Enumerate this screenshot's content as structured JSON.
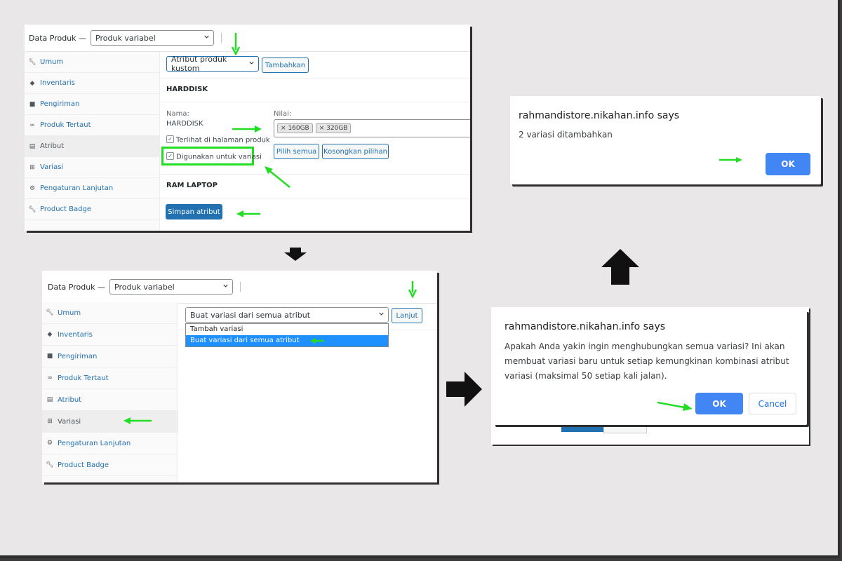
{
  "panel1": {
    "data_label": "Data Produk —",
    "product_type": "Produk variabel",
    "attribute_select": "Atribut produk kustom",
    "add_button": "Tambahkan",
    "attr1_title": "HARDDISK",
    "name_label": "Nama:",
    "name_value": "HARDDISK",
    "values_label": "Nilai:",
    "values": [
      "160GB",
      "320GB"
    ],
    "visible_checkbox": "Terlihat di halaman produk",
    "variation_checkbox": "Digunakan untuk variasi",
    "select_all_button": "Pilih semua",
    "clear_button": "Kosongkan pilihan",
    "attr2_title": "RAM LAPTOP",
    "save_button": "Simpan atribut"
  },
  "sidebar": {
    "items": [
      {
        "label": "Umum",
        "icon": "wrench-icon"
      },
      {
        "label": "Inventaris",
        "icon": "tag-icon"
      },
      {
        "label": "Pengiriman",
        "icon": "truck-icon"
      },
      {
        "label": "Produk Tertaut",
        "icon": "link-icon"
      },
      {
        "label": "Atribut",
        "icon": "list-icon"
      },
      {
        "label": "Variasi",
        "icon": "grid-icon"
      },
      {
        "label": "Pengaturan Lanjutan",
        "icon": "gear-icon"
      },
      {
        "label": "Product Badge",
        "icon": "wrench-icon"
      }
    ]
  },
  "panel2": {
    "data_label": "Data Produk —",
    "product_type": "Produk variabel",
    "variation_select": "Buat variasi dari semua atribut",
    "go_button": "Lanjut",
    "dropdown_options": [
      "Tambah variasi",
      "Buat variasi dari semua atribut"
    ]
  },
  "dialog_confirm": {
    "title": "rahmandistore.nikahan.info says",
    "message_lines": [
      "Apakah Anda yakin ingin menghubungkan semua variasi? Ini akan",
      "membuat variasi baru untuk setiap kemungkinan kombinasi atribut",
      "variasi (maksimal 50 setiap kali jalan)."
    ],
    "ok": "OK",
    "cancel": "Cancel"
  },
  "dialog_result": {
    "title": "rahmandistore.nikahan.info says",
    "message": "2 variasi ditambahkan",
    "ok": "OK"
  },
  "colors": {
    "wp_blue": "#2271b1",
    "highlight_green": "#22dd22",
    "chrome_blue": "#4285f4"
  }
}
